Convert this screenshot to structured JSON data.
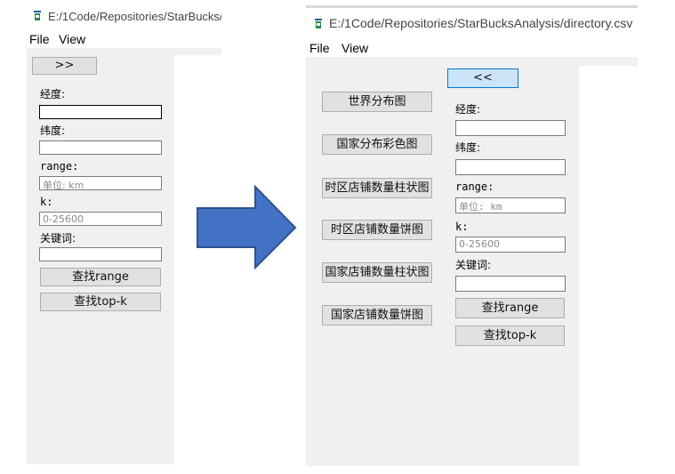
{
  "left_window": {
    "title": "E:/1Code/Repositories/StarBucks/",
    "menu": [
      "File",
      "View"
    ],
    "toggle_label": ">>",
    "longitude_label": "经度:",
    "longitude_value": "",
    "latitude_label": "纬度:",
    "latitude_value": "",
    "range_label": "range:",
    "range_placeholder": "单位: km",
    "k_label": "k:",
    "k_placeholder": "0-25600",
    "keyword_label": "关键词:",
    "keyword_value": "",
    "search_range_label": "查找range",
    "search_topk_label": "查找top-k"
  },
  "right_window": {
    "title": "E:/1Code/Repositories/StarBucksAnalysis/directory.csv",
    "menu": [
      "File",
      "View"
    ],
    "toggle_label": "<<",
    "chart_buttons": [
      "世界分布图",
      "国家分布彩色图",
      "时区店铺数量柱状图",
      "时区店铺数量饼图",
      "国家店铺数量柱状图",
      "国家店铺数量饼图"
    ],
    "longitude_label": "经度:",
    "longitude_value": "",
    "latitude_label": "纬度:",
    "latitude_value": "",
    "range_label": "range:",
    "range_placeholder": "单位: km",
    "k_label": "k:",
    "k_placeholder": "0-25600",
    "keyword_label": "关键词:",
    "keyword_value": "",
    "search_range_label": "查找range",
    "search_topk_label": "查找top-k"
  },
  "arrow_color": "#4472c4",
  "arrow_border_color": "#2f528f"
}
